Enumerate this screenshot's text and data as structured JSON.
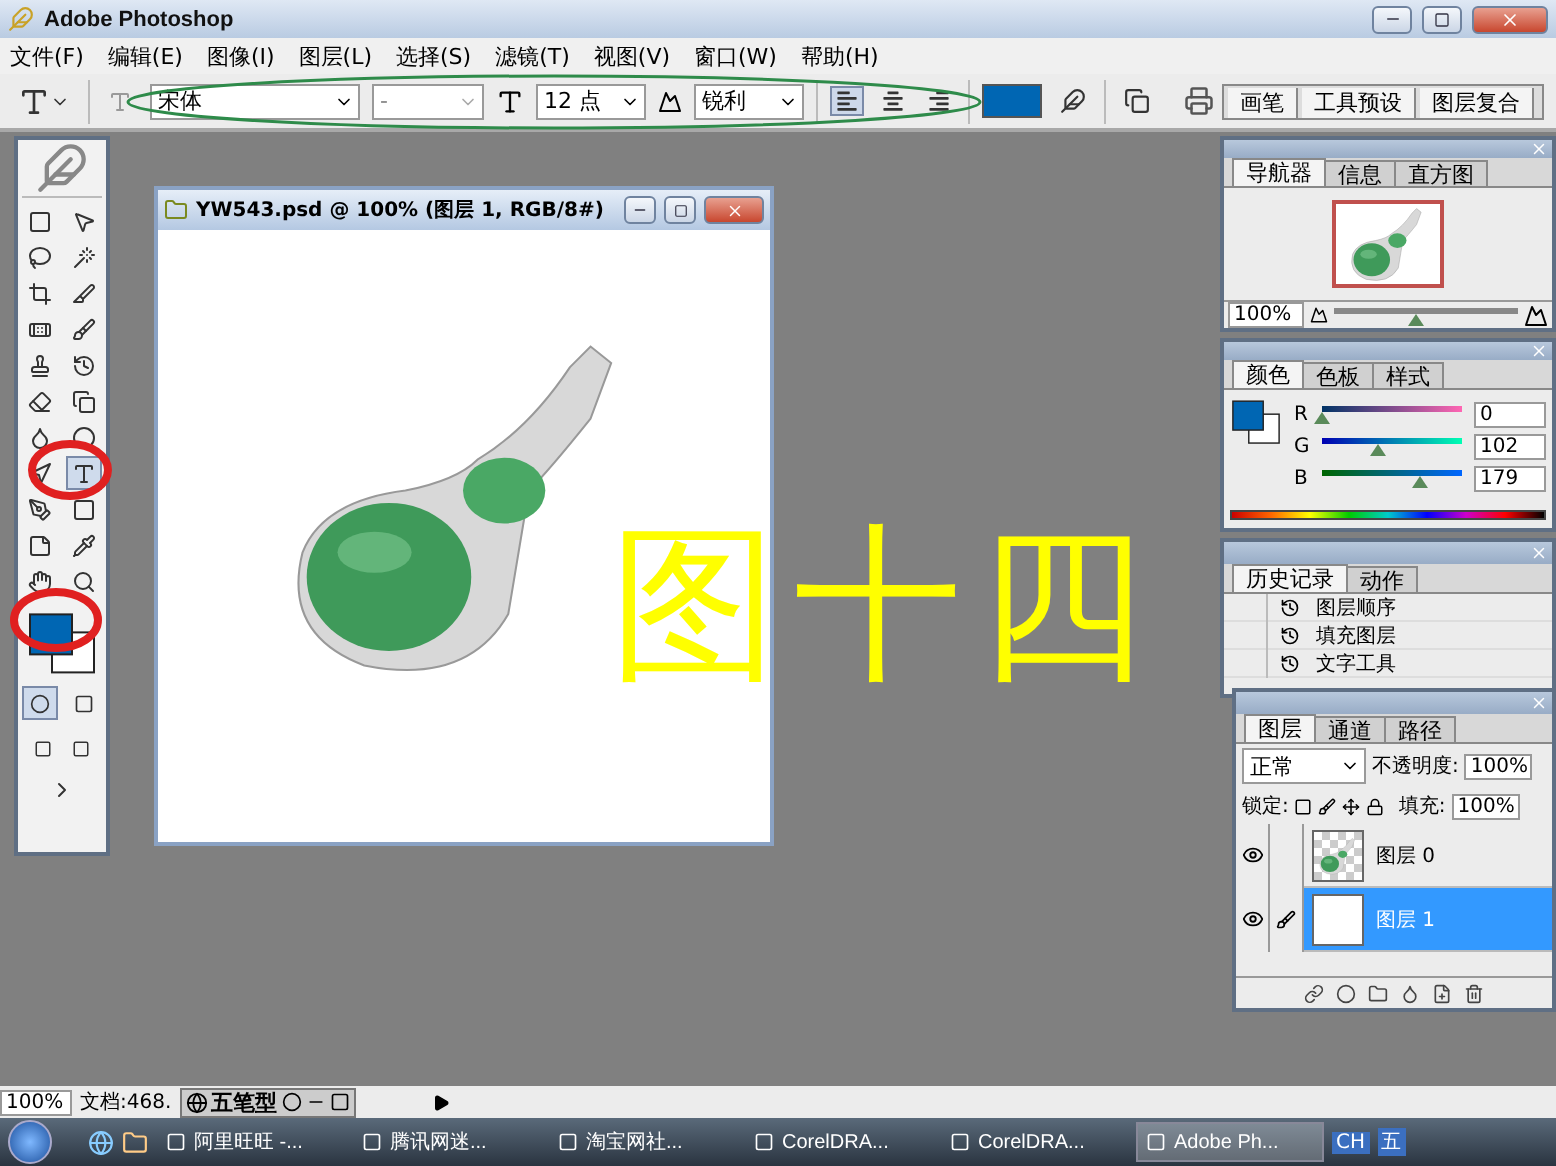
{
  "app": {
    "title": "Adobe Photoshop"
  },
  "menu": [
    "文件(F)",
    "编辑(E)",
    "图像(I)",
    "图层(L)",
    "选择(S)",
    "滤镜(T)",
    "视图(V)",
    "窗口(W)",
    "帮助(H)"
  ],
  "options_bar": {
    "font_family": "宋体",
    "font_style": "-",
    "font_size": "12 点",
    "antialias": "锐利",
    "align": [
      {
        "kind": "left",
        "selected": true
      },
      {
        "kind": "center",
        "selected": false
      },
      {
        "kind": "right",
        "selected": false
      }
    ],
    "palette_tabs": [
      "画笔",
      "工具预设",
      "图层复合"
    ]
  },
  "toolbox": {
    "tools": [
      {
        "kind": "marquee",
        "selected": false
      },
      {
        "kind": "move",
        "selected": false
      },
      {
        "kind": "lasso",
        "selected": false
      },
      {
        "kind": "wand",
        "selected": false
      },
      {
        "kind": "crop",
        "selected": false
      },
      {
        "kind": "slice",
        "selected": false
      },
      {
        "kind": "healing",
        "selected": false
      },
      {
        "kind": "brush",
        "selected": false
      },
      {
        "kind": "stamp",
        "selected": false
      },
      {
        "kind": "history",
        "selected": false
      },
      {
        "kind": "eraser",
        "selected": false
      },
      {
        "kind": "gradient",
        "selected": false
      },
      {
        "kind": "blur",
        "selected": false
      },
      {
        "kind": "burn",
        "selected": false
      },
      {
        "kind": "path",
        "selected": false
      },
      {
        "kind": "type",
        "selected": true
      },
      {
        "kind": "pen",
        "selected": false
      },
      {
        "kind": "shape",
        "selected": false
      },
      {
        "kind": "notes",
        "selected": false
      },
      {
        "kind": "eyedropper",
        "selected": false
      },
      {
        "kind": "hand",
        "selected": false
      },
      {
        "kind": "zoom",
        "selected": false
      }
    ]
  },
  "document": {
    "title": "YW543.psd @ 100% (图层 1, RGB/8#)"
  },
  "annotation": "图十四",
  "navigator": {
    "tabs": [
      {
        "label": "导航器",
        "selected": true
      },
      {
        "label": "信息",
        "selected": false
      },
      {
        "label": "直方图",
        "selected": false
      }
    ],
    "zoom": "100%",
    "level": 0.45
  },
  "color": {
    "tabs": [
      {
        "label": "颜色",
        "selected": true
      },
      {
        "label": "色板",
        "selected": false
      },
      {
        "label": "样式",
        "selected": false
      }
    ],
    "channels": [
      {
        "name": "R",
        "value": "0",
        "level": 0.0
      },
      {
        "name": "G",
        "value": "102",
        "level": 0.4
      },
      {
        "name": "B",
        "value": "179",
        "level": 0.7
      }
    ]
  },
  "history": {
    "tabs": [
      {
        "label": "历史记录",
        "selected": true
      },
      {
        "label": "动作",
        "selected": false
      }
    ],
    "items": [
      "图层顺序",
      "填充图层",
      "文字工具"
    ]
  },
  "layers": {
    "tabs": [
      {
        "label": "图层",
        "selected": true
      },
      {
        "label": "通道",
        "selected": false
      },
      {
        "label": "路径",
        "selected": false
      }
    ],
    "blend_mode": "正常",
    "opacity_label": "不透明度:",
    "opacity": "100%",
    "lock_label": "锁定:",
    "fill_label": "填充:",
    "fill": "100%",
    "items": [
      {
        "name": "图层 0",
        "visible": true,
        "selected": false
      },
      {
        "name": "图层 1",
        "visible": true,
        "selected": true
      }
    ]
  },
  "status_bar": {
    "zoom": "100%",
    "doc_info": "文档:468.",
    "ime": "五笔型"
  },
  "taskbar": {
    "tasks": [
      {
        "label": "阿里旺旺 -...",
        "selected": false
      },
      {
        "label": "腾讯网迷...",
        "selected": false
      },
      {
        "label": "淘宝网社...",
        "selected": false
      },
      {
        "label": "CorelDRA...",
        "selected": false
      },
      {
        "label": "CorelDRA...",
        "selected": false
      },
      {
        "label": "Adobe Ph...",
        "selected": true
      }
    ],
    "tray": [
      "CH",
      "五"
    ]
  }
}
